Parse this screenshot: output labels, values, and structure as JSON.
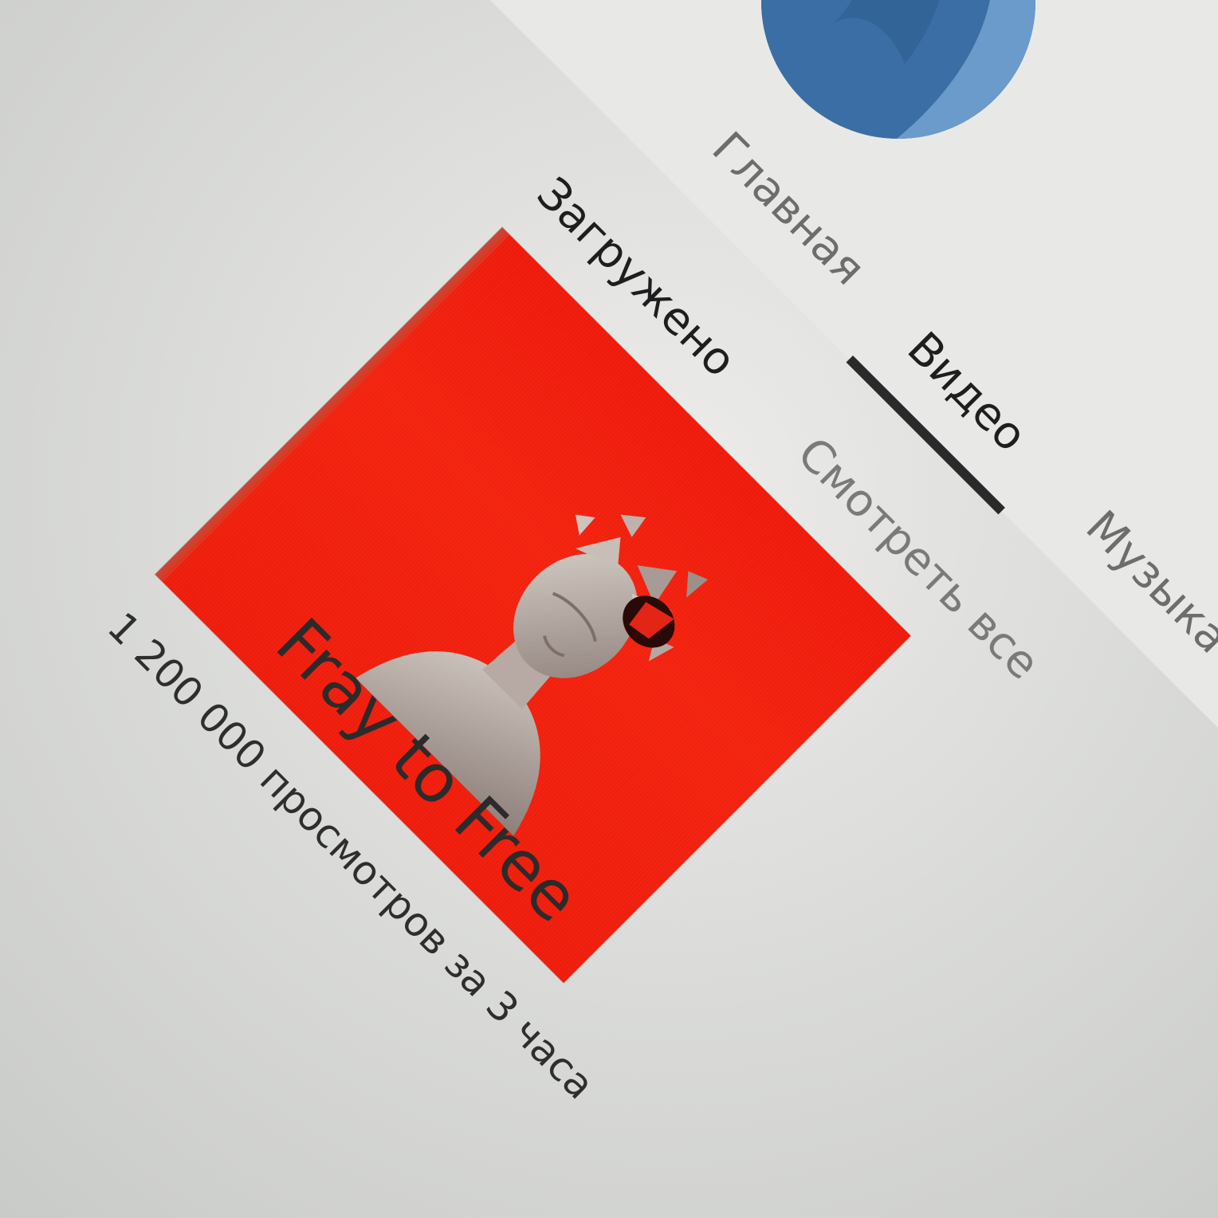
{
  "header": {
    "tabs": [
      {
        "label": "Главная",
        "active": false
      },
      {
        "label": "Видео",
        "active": true
      },
      {
        "label": "Музыка",
        "active": false
      }
    ]
  },
  "section": {
    "title": "Загружено",
    "see_all": "Смотреть все"
  },
  "video": {
    "title": "Fray to Free",
    "views": "1 200 000 просмотров за 3 часа"
  },
  "colors": {
    "accent_blue": "#3b6ea4",
    "thumbnail_red": "#ee1a0c",
    "active_tab_underline": "#2a2a2a"
  }
}
